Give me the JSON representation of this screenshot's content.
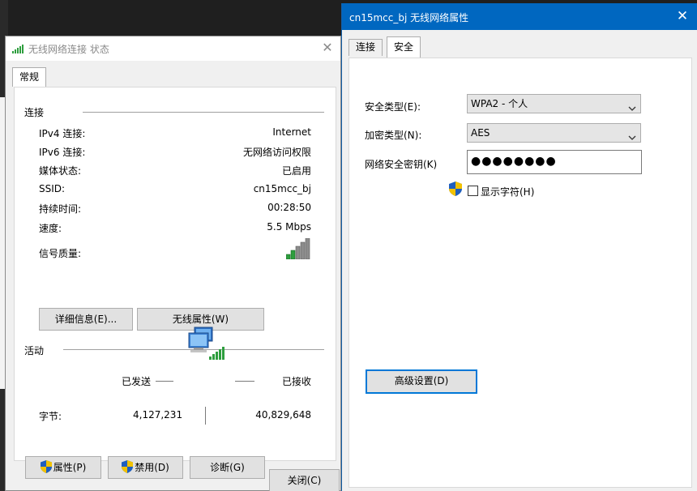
{
  "status_window": {
    "title": "无线网络连接 状态",
    "tab_general": "常规",
    "connection_section": "连接",
    "rows": [
      {
        "label": "IPv4 连接:",
        "value": "Internet"
      },
      {
        "label": "IPv6 连接:",
        "value": "无网络访问权限"
      },
      {
        "label": "媒体状态:",
        "value": "已启用"
      },
      {
        "label": "SSID:",
        "value": "cn15mcc_bj"
      },
      {
        "label": "持续时间:",
        "value": "00:28:50"
      },
      {
        "label": "速度:",
        "value": "5.5 Mbps"
      }
    ],
    "signal_label": "信号质量:",
    "signal_bars": 5,
    "details_button": "详细信息(E)...",
    "wireless_props_button": "无线属性(W)",
    "activity_section": "活动",
    "sent_label": "已发送",
    "received_label": "已接收",
    "bytes_label": "字节:",
    "bytes_sent": "4,127,231",
    "bytes_received": "40,829,648",
    "properties_button": "属性(P)",
    "disable_button": "禁用(D)",
    "diagnose_button": "诊断(G)",
    "close_button": "关闭(C)"
  },
  "props_window": {
    "title": "cn15mcc_bj 无线网络属性",
    "tab_connection": "连接",
    "tab_security": "安全",
    "security_type_label": "安全类型(E):",
    "security_type_value": "WPA2 - 个人",
    "encryption_type_label": "加密类型(N):",
    "encryption_type_value": "AES",
    "key_label": "网络安全密钥(K)",
    "key_masked": "●●●●●●●●",
    "show_chars_label": "显示字符(H)",
    "show_chars_checked": false,
    "advanced_button": "高级设置(D)"
  },
  "colors": {
    "accent": "#0067c0",
    "signal_green": "#2e9e3e"
  }
}
